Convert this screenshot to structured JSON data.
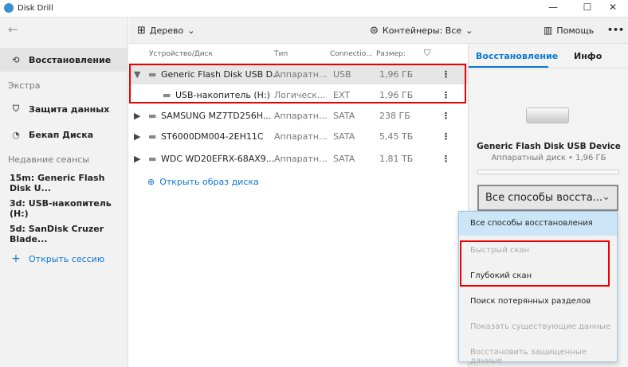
{
  "window": {
    "title": "Disk Drill",
    "minimize": "—",
    "maximize": "☐",
    "close": "✕"
  },
  "sidebar": {
    "back": "←",
    "items": [
      {
        "label": "Восстановление",
        "icon": "recovery-icon"
      },
      {
        "label": "Экстра"
      },
      {
        "label": "Защита данных",
        "icon": "shield-icon"
      },
      {
        "label": "Бекап Диска",
        "icon": "backup-icon"
      },
      {
        "label": "Недавние сеансы"
      },
      {
        "label": "15m: Generic Flash Disk U..."
      },
      {
        "label": "3d: USB-накопитель (H:)"
      },
      {
        "label": "5d: SanDisk Cruzer Blade..."
      },
      {
        "label": "Открыть сессию",
        "icon": "plus-icon"
      }
    ]
  },
  "toolbar": {
    "view": "Дерево",
    "containers": "Контейнеры: Все",
    "help": "Помощь",
    "more": "•••"
  },
  "table": {
    "headers": [
      "Устройство/Диск",
      "Тип",
      "Connectio...",
      "Размер:"
    ],
    "rows": [
      {
        "name": "Generic Flash Disk USB D...",
        "type": "Аппаратн...",
        "conn": "USB",
        "size": "1,96 ГБ",
        "expanded": true
      },
      {
        "name": "USB-накопитель (H:)",
        "type": "Логическ...",
        "conn": "EXT",
        "size": "1,96 ГБ"
      },
      {
        "name": "SAMSUNG MZ7TD256H...",
        "type": "Аппаратн...",
        "conn": "SATA",
        "size": "238 ГБ"
      },
      {
        "name": "ST6000DM004-2EH11C",
        "type": "Аппаратн...",
        "conn": "SATA",
        "size": "5,45 ТБ"
      },
      {
        "name": "WDC WD20EFRX-68AX9...",
        "type": "Аппаратн...",
        "conn": "SATA",
        "size": "1,81 ТБ"
      }
    ],
    "open_image": "Открыть образ диска"
  },
  "right": {
    "tabs": [
      "Восстановление",
      "Инфо"
    ],
    "device": "Generic Flash Disk USB Device",
    "sub": "Аппаратный диск • 1,96 ГБ",
    "dropdown": "Все способы восста...",
    "menu": [
      {
        "label": "Все способы восстановления",
        "enabled": true
      },
      {
        "label": "Быстрый скан",
        "enabled": false
      },
      {
        "label": "Глубокий скан",
        "enabled": true
      },
      {
        "label": "Поиск потерянных разделов",
        "enabled": true
      },
      {
        "label": "Показать существующие данные",
        "enabled": false
      },
      {
        "label": "Восстановить защищенные данные",
        "enabled": false
      }
    ]
  },
  "colors": {
    "accent": "#0a78d4",
    "highlight": "#e00000",
    "menu_sel": "#cce6f7"
  }
}
